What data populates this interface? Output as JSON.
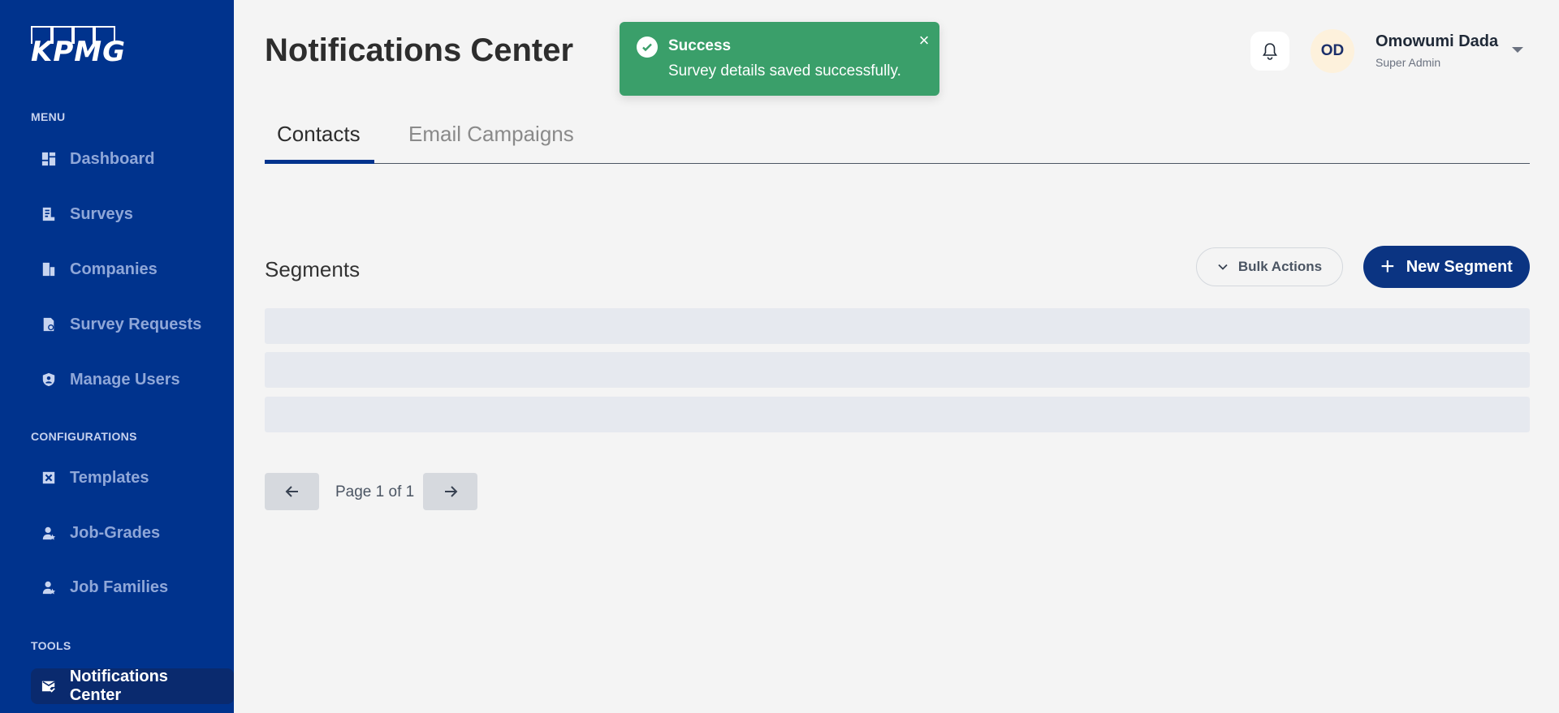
{
  "sidebar": {
    "logo_text": "KPMG",
    "sections": {
      "menu": "MENU",
      "configurations": "CONFIGURATIONS",
      "tools": "TOOLS"
    },
    "items": {
      "dashboard": "Dashboard",
      "surveys": "Surveys",
      "companies": "Companies",
      "survey_requests": "Survey Requests",
      "manage_users": "Manage Users",
      "templates": "Templates",
      "job_grades": "Job-Grades",
      "job_families": "Job Families",
      "notifications_center": "Notifications Center"
    },
    "active_item": "notifications_center"
  },
  "header": {
    "title": "Notifications Center",
    "user": {
      "initials": "OD",
      "name": "Omowumi Dada",
      "role": "Super Admin"
    }
  },
  "toast": {
    "title": "Success",
    "message": "Survey details saved successfully.",
    "close": "×",
    "color": "#3a9f6a"
  },
  "tabs": {
    "contacts": "Contacts",
    "email_campaigns": "Email Campaigns",
    "active": "contacts"
  },
  "segments": {
    "title": "Segments",
    "bulk_actions": "Bulk Actions",
    "new_segment": "New Segment"
  },
  "pagination": {
    "text": "Page 1 of 1"
  },
  "colors": {
    "sidebar_bg": "#00338d",
    "accent": "#0b3482",
    "page_bg": "#f4f4f4"
  }
}
